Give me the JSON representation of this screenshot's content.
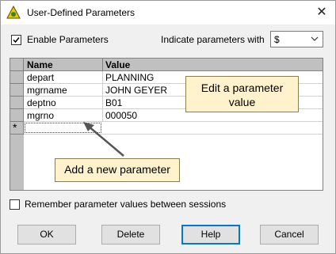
{
  "window": {
    "title": "User-Defined Parameters",
    "close_glyph": "✕"
  },
  "options": {
    "enable_label": "Enable Parameters",
    "enable_checked": true,
    "indicate_label": "Indicate parameters with",
    "indicate_value": "$",
    "remember_label": "Remember parameter values between sessions",
    "remember_checked": false
  },
  "grid": {
    "col_name": "Name",
    "col_value": "Value",
    "rows": [
      {
        "name": "depart",
        "value": "PLANNING"
      },
      {
        "name": "mgrname",
        "value": "JOHN GEYER"
      },
      {
        "name": "deptno",
        "value": "B01"
      },
      {
        "name": "mgrno",
        "value": "000050"
      }
    ],
    "new_row_marker": "*"
  },
  "callouts": {
    "edit": "Edit a parameter value",
    "add": "Add a new parameter"
  },
  "buttons": {
    "ok": "OK",
    "delete": "Delete",
    "help": "Help",
    "cancel": "Cancel"
  },
  "colors": {
    "callout_bg": "#fff2cc",
    "grid_header": "#c0c0c0",
    "default_button_border": "#0078d7"
  }
}
